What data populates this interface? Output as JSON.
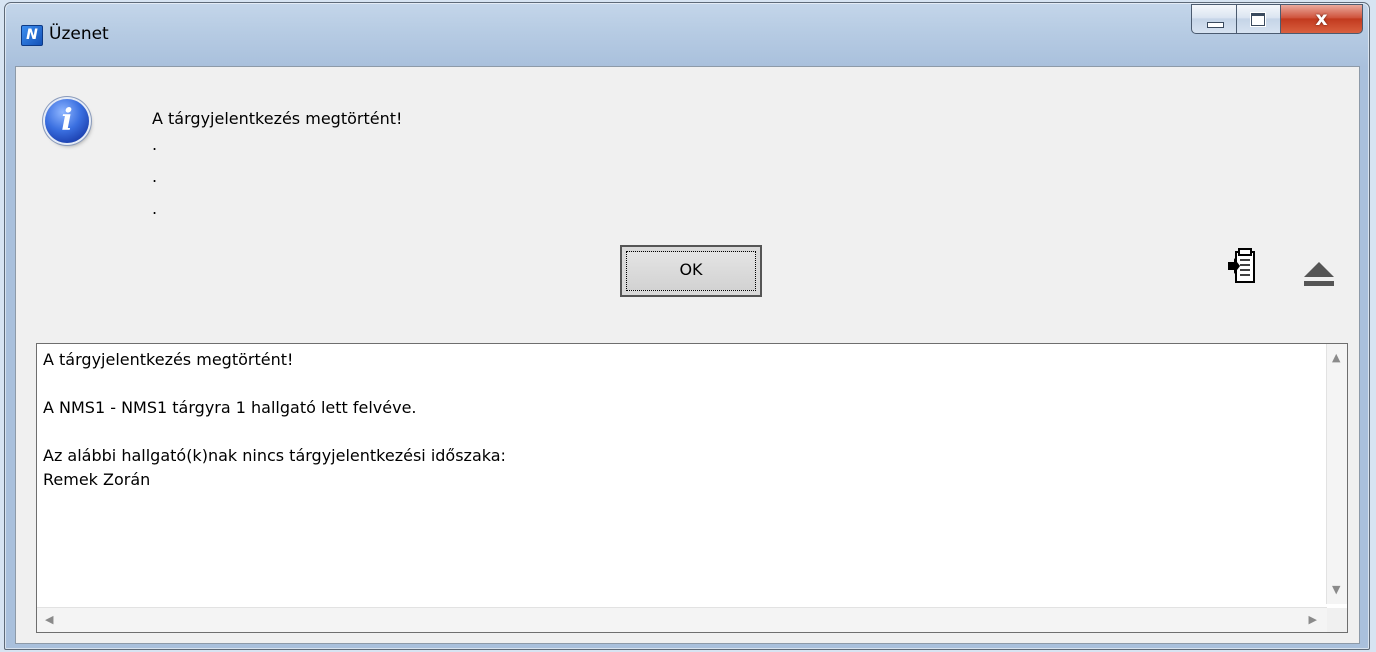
{
  "window": {
    "title": "Üzenet",
    "app_icon_letter": "N",
    "close_glyph": "x"
  },
  "message": {
    "headline": "A tárgyjelentkezés megtörtént!",
    "dots": [
      ".",
      ".",
      "."
    ]
  },
  "buttons": {
    "ok_label": "OK"
  },
  "details": {
    "lines": [
      "A tárgyjelentkezés megtörtént!",
      "",
      "A NMS1 - NMS1 tárgyra 1 hallgató lett felvéve.",
      "",
      "Az alábbi hallgató(k)nak nincs tárgyjelentkezési időszaka:",
      "Remek Zorán"
    ]
  },
  "icons": {
    "info": "info-icon",
    "copy": "clipboard-icon",
    "collapse": "eject-icon"
  },
  "colors": {
    "info_blue": "#2a55c8",
    "close_red": "#c94a2e"
  }
}
